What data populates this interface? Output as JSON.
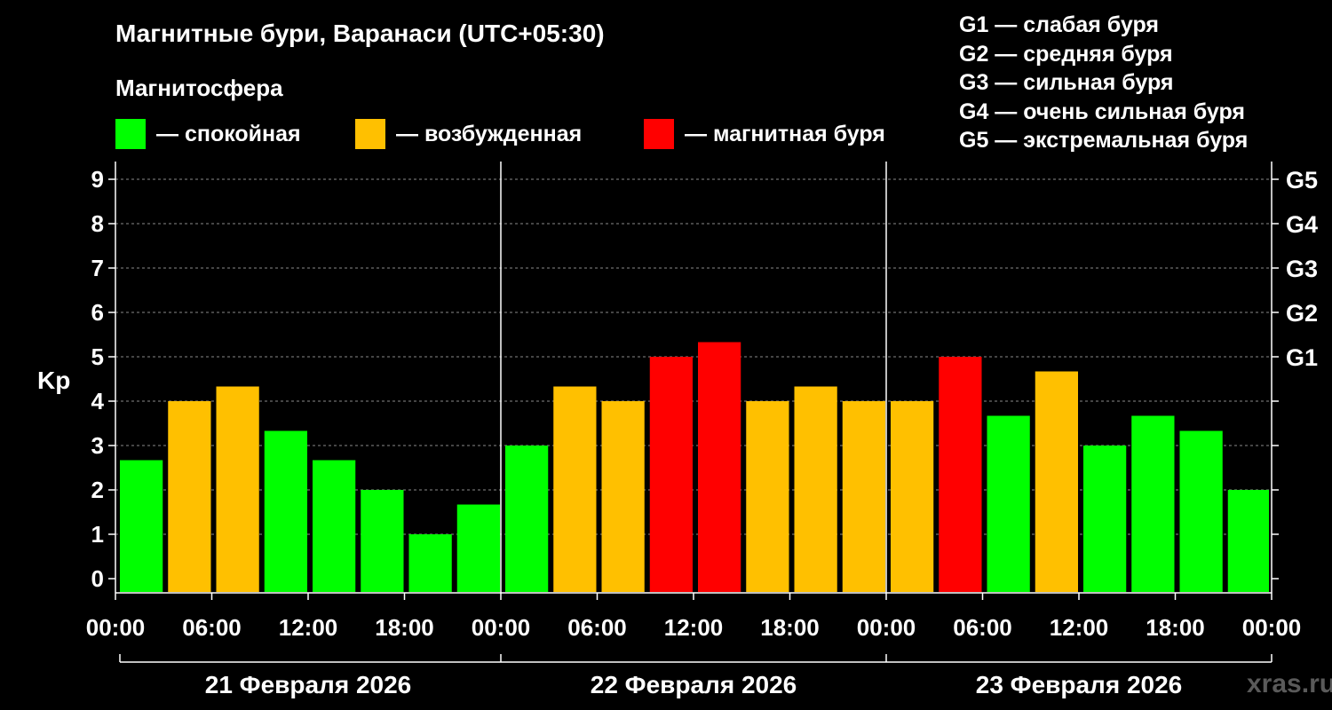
{
  "title": "Магнитные бури, Варанаси (UTC+05:30)",
  "subtitle": "Магнитосфера",
  "legend": [
    {
      "label": "— спокойная",
      "color": "#00ff00"
    },
    {
      "label": "— возбужденная",
      "color": "#ffc000"
    },
    {
      "label": "— магнитная буря",
      "color": "#ff0000"
    }
  ],
  "g_scale": [
    "G1 — слабая буря",
    "G2 — средняя буря",
    "G3 — сильная буря",
    "G4 — очень сильная буря",
    "G5 — экстремальная буря"
  ],
  "watermark": "xras.ru",
  "colors": {
    "quiet": "#00ff00",
    "active": "#ffc000",
    "storm": "#ff0000",
    "background": "#000000"
  },
  "chart_data": {
    "type": "bar",
    "ylabel": "Kp",
    "ylim": [
      0,
      9
    ],
    "yticks": [
      "0",
      "1",
      "2",
      "3",
      "4",
      "5",
      "6",
      "7",
      "8",
      "9"
    ],
    "right_ticks": [
      {
        "kp": 5,
        "label": "G1"
      },
      {
        "kp": 6,
        "label": "G2"
      },
      {
        "kp": 7,
        "label": "G3"
      },
      {
        "kp": 8,
        "label": "G4"
      },
      {
        "kp": 9,
        "label": "G5"
      }
    ],
    "x_tick_labels": [
      "00:00",
      "06:00",
      "12:00",
      "18:00",
      "00:00",
      "06:00",
      "12:00",
      "18:00",
      "00:00",
      "06:00",
      "12:00",
      "18:00",
      "00:00"
    ],
    "days": [
      "21 Февраля 2026",
      "22 Февраля 2026",
      "23 Февраля 2026"
    ],
    "grid": "horizontal dashed",
    "bar_interval_hours": 3,
    "values": [
      2.67,
      4.0,
      4.33,
      3.33,
      2.67,
      2.0,
      1.0,
      1.67,
      3.0,
      4.33,
      4.0,
      5.0,
      5.33,
      4.0,
      4.33,
      4.0,
      4.0,
      5.0,
      3.67,
      4.67,
      3.0,
      3.67,
      3.33,
      2.0,
      2.0
    ],
    "levels": [
      "quiet",
      "active",
      "active",
      "quiet",
      "quiet",
      "quiet",
      "quiet",
      "quiet",
      "quiet",
      "active",
      "active",
      "storm",
      "storm",
      "active",
      "active",
      "active",
      "active",
      "storm",
      "quiet",
      "active",
      "quiet",
      "quiet",
      "quiet",
      "quiet",
      "quiet"
    ]
  }
}
